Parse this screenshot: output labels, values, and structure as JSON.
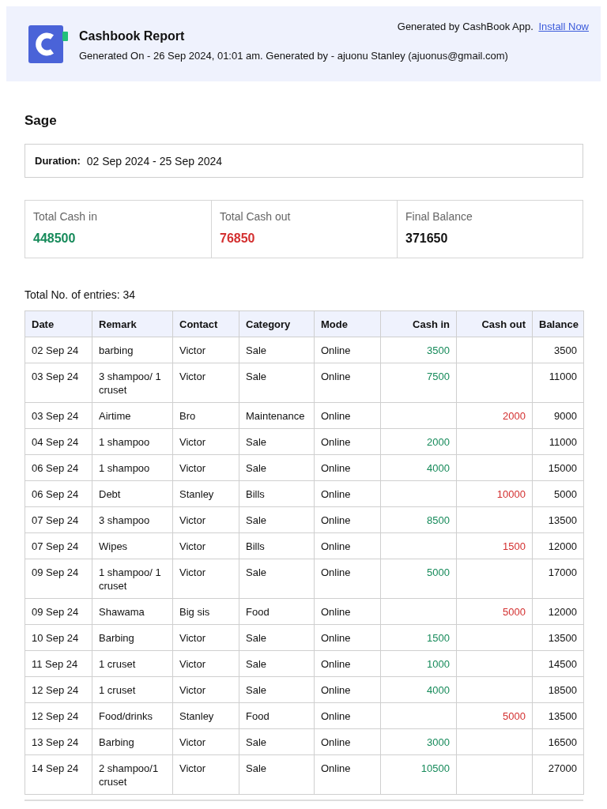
{
  "header": {
    "title": "Cashbook Report",
    "subtitle": "Generated On - 26 Sep 2024, 01:01 am. Generated by - ajuonu Stanley (ajuonus@gmail.com)",
    "generated_by": "Generated by CashBook App.",
    "install_link": "Install Now"
  },
  "book_name": "Sage",
  "duration": {
    "label": "Duration:",
    "value": "02 Sep 2024 - 25 Sep 2024"
  },
  "summary": [
    {
      "label": "Total Cash in",
      "value": "448500",
      "kind": "in"
    },
    {
      "label": "Total Cash out",
      "value": "76850",
      "kind": "out"
    },
    {
      "label": "Final Balance",
      "value": "371650",
      "kind": "balance"
    }
  ],
  "entries_count": "Total No. of entries: 34",
  "table": {
    "columns": [
      "Date",
      "Remark",
      "Contact",
      "Category",
      "Mode",
      "Cash in",
      "Cash out",
      "Balance"
    ],
    "rows": [
      {
        "date": "02 Sep 24",
        "remark": "barbing",
        "contact": "Victor",
        "category": "Sale",
        "mode": "Online",
        "cash_in": "3500",
        "balance": "3500"
      },
      {
        "date": "03 Sep 24",
        "remark": "3 shampoo/ 1 cruset",
        "contact": "Victor",
        "category": "Sale",
        "mode": "Online",
        "cash_in": "7500",
        "balance": "11000"
      },
      {
        "date": "03 Sep 24",
        "remark": "Airtime",
        "contact": "Bro",
        "category": "Maintenance",
        "mode": "Online",
        "cash_out": "2000",
        "balance": "9000"
      },
      {
        "date": "04 Sep 24",
        "remark": "1 shampoo",
        "contact": "Victor",
        "category": "Sale",
        "mode": "Online",
        "cash_in": "2000",
        "balance": "11000"
      },
      {
        "date": "06 Sep 24",
        "remark": "1 shampoo",
        "contact": "Victor",
        "category": "Sale",
        "mode": "Online",
        "cash_in": "4000",
        "balance": "15000"
      },
      {
        "date": "06 Sep 24",
        "remark": "Debt",
        "contact": "Stanley",
        "category": "Bills",
        "mode": "Online",
        "cash_out": "10000",
        "balance": "5000"
      },
      {
        "date": "07 Sep 24",
        "remark": "3 shampoo",
        "contact": "Victor",
        "category": "Sale",
        "mode": "Online",
        "cash_in": "8500",
        "balance": "13500"
      },
      {
        "date": "07 Sep 24",
        "remark": "Wipes",
        "contact": "Victor",
        "category": "Bills",
        "mode": "Online",
        "cash_out": "1500",
        "balance": "12000"
      },
      {
        "date": "09 Sep 24",
        "remark": "1 shampoo/ 1 cruset",
        "contact": "Victor",
        "category": "Sale",
        "mode": "Online",
        "cash_in": "5000",
        "balance": "17000"
      },
      {
        "date": "09 Sep 24",
        "remark": "Shawama",
        "contact": "Big sis",
        "category": "Food",
        "mode": "Online",
        "cash_out": "5000",
        "balance": "12000"
      },
      {
        "date": "10 Sep 24",
        "remark": "Barbing",
        "contact": "Victor",
        "category": "Sale",
        "mode": "Online",
        "cash_in": "1500",
        "balance": "13500"
      },
      {
        "date": "11 Sep 24",
        "remark": "1 cruset",
        "contact": "Victor",
        "category": "Sale",
        "mode": "Online",
        "cash_in": "1000",
        "balance": "14500"
      },
      {
        "date": "12 Sep 24",
        "remark": "1 cruset",
        "contact": "Victor",
        "category": "Sale",
        "mode": "Online",
        "cash_in": "4000",
        "balance": "18500"
      },
      {
        "date": "12 Sep 24",
        "remark": "Food/drinks",
        "contact": "Stanley",
        "category": "Food",
        "mode": "Online",
        "cash_out": "5000",
        "balance": "13500"
      },
      {
        "date": "13 Sep 24",
        "remark": "Barbing",
        "contact": "Victor",
        "category": "Sale",
        "mode": "Online",
        "cash_in": "3000",
        "balance": "16500"
      },
      {
        "date": "14 Sep 24",
        "remark": "2 shampoo/1 cruset",
        "contact": "Victor",
        "category": "Sale",
        "mode": "Online",
        "cash_in": "10500",
        "balance": "27000"
      }
    ]
  }
}
